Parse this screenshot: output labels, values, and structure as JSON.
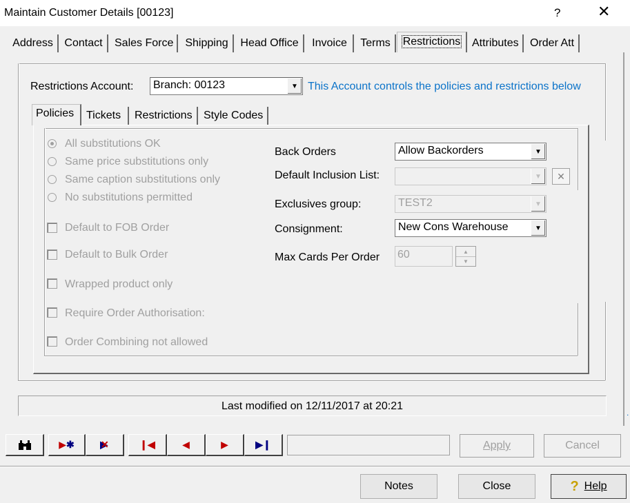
{
  "window": {
    "title": "Maintain Customer Details [00123]",
    "help_glyph": "?",
    "close_glyph": "✕"
  },
  "outer_tabs": [
    "Address",
    "Contact",
    "Sales Force",
    "Shipping",
    "Head Office",
    "Invoice",
    "Terms",
    "Restrictions",
    "Attributes",
    "Order Att"
  ],
  "active_outer_tab": "Restrictions",
  "restrictions_account": {
    "label": "Restrictions Account:",
    "value": "Branch: 00123",
    "info": "This Account controls the policies and restrictions below"
  },
  "inner_tabs": [
    "Policies",
    "Tickets",
    "Restrictions",
    "Style Codes"
  ],
  "active_inner_tab": "Policies",
  "substitution_options": [
    {
      "label": "All substitutions OK",
      "checked": true
    },
    {
      "label": "Same price substitutions only",
      "checked": false
    },
    {
      "label": "Same caption substitutions only",
      "checked": false
    },
    {
      "label": "No substitutions permitted",
      "checked": false
    }
  ],
  "checkbox_options": [
    "Default to FOB Order",
    "Default to Bulk Order",
    "Wrapped product only",
    "Require Order Authorisation:",
    "Order Combining not allowed"
  ],
  "fields": {
    "back_orders": {
      "label": "Back Orders",
      "value": "Allow Backorders"
    },
    "default_inclusion": {
      "label": "Default Inclusion List:",
      "value": ""
    },
    "exclusives_group": {
      "label": "Exclusives group:",
      "value": "TEST2"
    },
    "consignment": {
      "label": "Consignment:",
      "value": "New Cons Warehouse"
    },
    "max_cards": {
      "label": "Max Cards Per Order",
      "value": "60"
    }
  },
  "status": "Last modified on 12/11/2017 at 20:21",
  "toolbar": {
    "apply": "Apply",
    "cancel": "Cancel"
  },
  "footer": {
    "notes": "Notes",
    "close": "Close",
    "help": "Help"
  }
}
